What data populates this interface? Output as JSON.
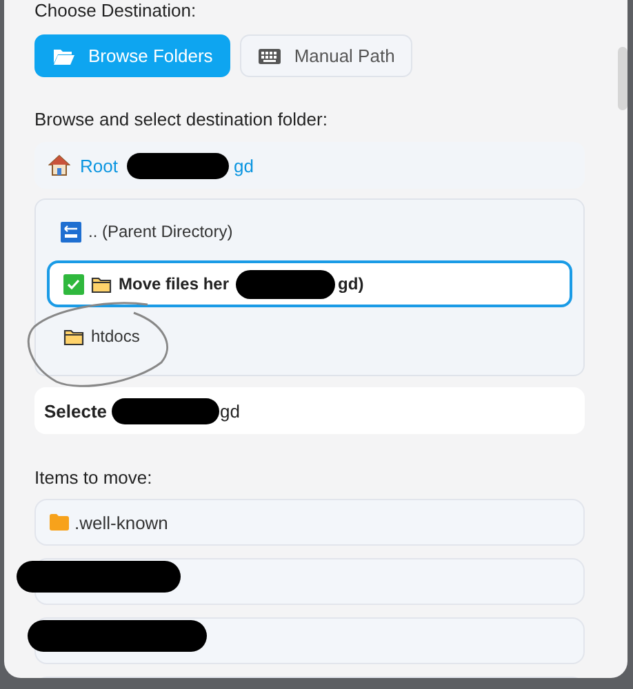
{
  "destination": {
    "label": "Choose Destination:",
    "modes": [
      {
        "label": "Browse Folders",
        "kind": "browse",
        "selected": true
      },
      {
        "label": "Manual Path",
        "kind": "manual",
        "selected": false
      }
    ]
  },
  "browser": {
    "label": "Browse and select destination folder:",
    "breadcrumb": {
      "root": "Root",
      "path_tail": "gd",
      "redacted": true
    },
    "entries": [
      {
        "kind": "parent",
        "label": ".. (Parent Directory)",
        "selected": false,
        "redacted": false,
        "circled": false
      },
      {
        "kind": "current",
        "label": "Move files her",
        "tail": "gd)",
        "selected": true,
        "redacted": true,
        "circled": false
      },
      {
        "kind": "folder",
        "label": "htdocs",
        "selected": false,
        "redacted": false,
        "circled": true
      }
    ],
    "selected": {
      "label": "Selecte",
      "tail": "gd",
      "redacted": true
    }
  },
  "items": {
    "label": "Items to move:",
    "rows": [
      {
        "kind": "folder",
        "name": ".well-known",
        "redacted": false
      },
      {
        "kind": "hidden",
        "redacted": true
      },
      {
        "kind": "hidden",
        "redacted": true
      },
      {
        "kind": "hidden",
        "redacted": false
      }
    ]
  }
}
